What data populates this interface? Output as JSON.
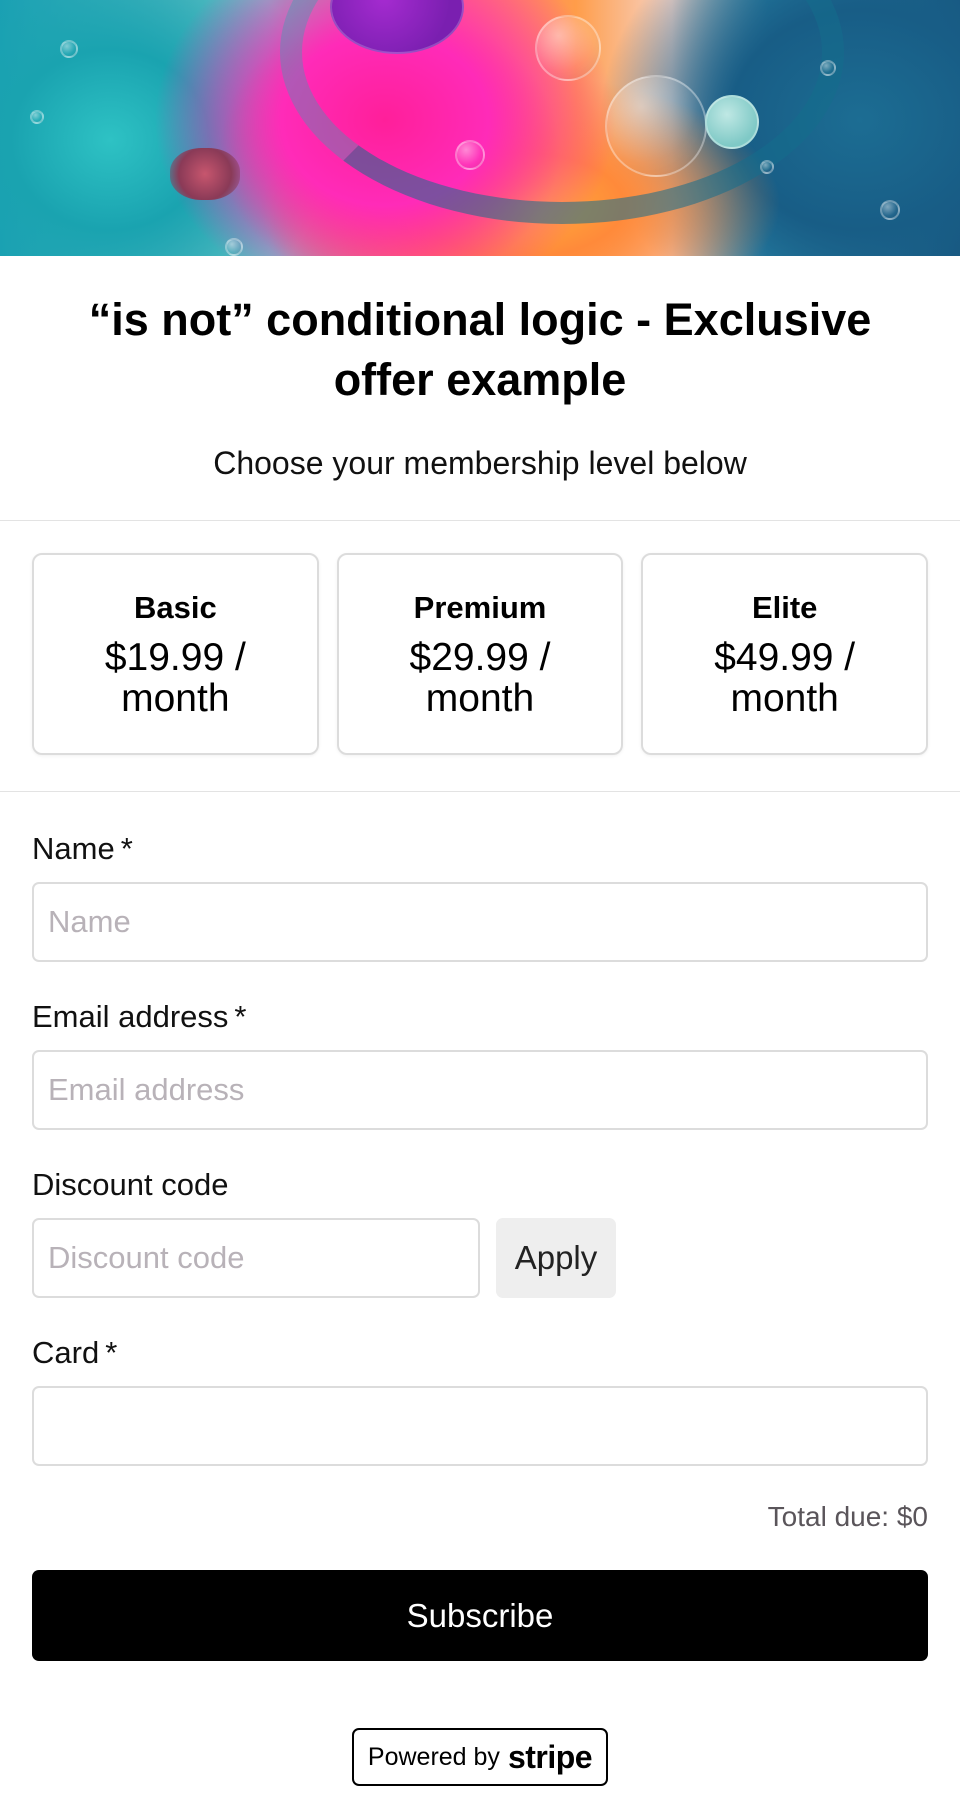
{
  "header": {
    "title": "“is not” conditional logic - Exclusive offer example",
    "subtitle": "Choose your membership level below"
  },
  "plans": [
    {
      "name": "Basic",
      "price": "$19.99 / month"
    },
    {
      "name": "Premium",
      "price": "$29.99 / month"
    },
    {
      "name": "Elite",
      "price": "$49.99 / month"
    }
  ],
  "form": {
    "name": {
      "label": "Name",
      "required": "*",
      "placeholder": "Name",
      "value": ""
    },
    "email": {
      "label": "Email address",
      "required": "*",
      "placeholder": "Email address",
      "value": ""
    },
    "discount": {
      "label": "Discount code",
      "placeholder": "Discount code",
      "value": "",
      "apply_label": "Apply"
    },
    "card": {
      "label": "Card",
      "required": "*",
      "value": ""
    }
  },
  "total": "Total due: $0",
  "subscribe_label": "Subscribe",
  "powered_by": {
    "text": "Powered by",
    "brand": "stripe"
  },
  "colors": {
    "primary_button": "#000000",
    "border": "#dcdcdc",
    "placeholder": "#b8b2b8"
  }
}
